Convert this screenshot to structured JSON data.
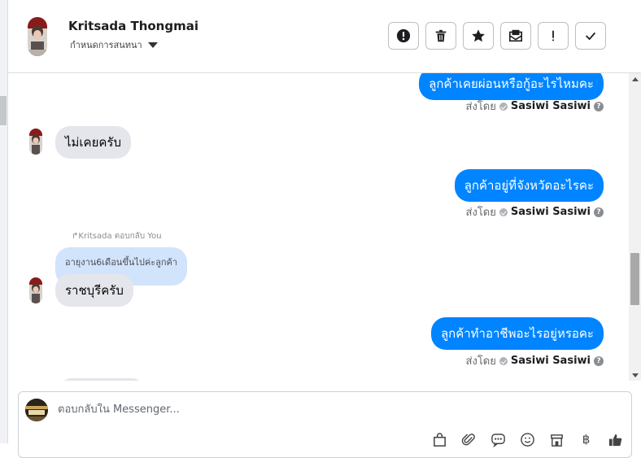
{
  "header": {
    "name": "Kritsada Thongmai",
    "subtitle": "กำหนดการสนทนา",
    "actions": [
      {
        "name": "report-button",
        "icon": "alert-circle-icon"
      },
      {
        "name": "delete-button",
        "icon": "trash-icon"
      },
      {
        "name": "star-button",
        "icon": "star-icon"
      },
      {
        "name": "mark-unread-button",
        "icon": "envelope-icon"
      },
      {
        "name": "important-button",
        "icon": "exclamation-icon"
      },
      {
        "name": "done-button",
        "icon": "check-icon"
      }
    ]
  },
  "messages": [
    {
      "dir": "out",
      "text": "ลูกค้าเคยผ่อนหรือกู้อะไรไหมคะ"
    },
    {
      "dir": "sent_by",
      "prefix": "ส่งโดย",
      "agent": "Sasiwi Sasiwi"
    },
    {
      "dir": "in",
      "text": "ไม่เคยครับ"
    },
    {
      "dir": "out",
      "text": "ลูกค้าอยู่ที่จังหวัดอะไรคะ"
    },
    {
      "dir": "sent_by",
      "prefix": "ส่งโดย",
      "agent": "Sasiwi Sasiwi"
    },
    {
      "dir": "reply_label",
      "text": "Kritsada ตอบกลับ You"
    },
    {
      "dir": "quote",
      "text": "อายุงาน6เดือนขึ้นไปค่ะลูกค้า"
    },
    {
      "dir": "in",
      "text": "ราชบุรีครับ"
    },
    {
      "dir": "out",
      "text": "ลูกค้าทำอาชีพอะไรอยู่หรอคะ"
    },
    {
      "dir": "sent_by",
      "prefix": "ส่งโดย",
      "agent": "Sasiwi Sasiwi"
    }
  ],
  "composer": {
    "placeholder": "ตอบกลับใน Messenger...",
    "tools": [
      "bag-icon",
      "paperclip-icon",
      "chat-dots-icon",
      "smiley-icon",
      "store-icon",
      "baht-icon",
      "thumbs-up-icon"
    ],
    "currency_symbol": "฿"
  },
  "colors": {
    "accent": "#0084ff",
    "incoming_bubble": "#e4e6eb",
    "quote_bubble": "#d2e3fc"
  }
}
